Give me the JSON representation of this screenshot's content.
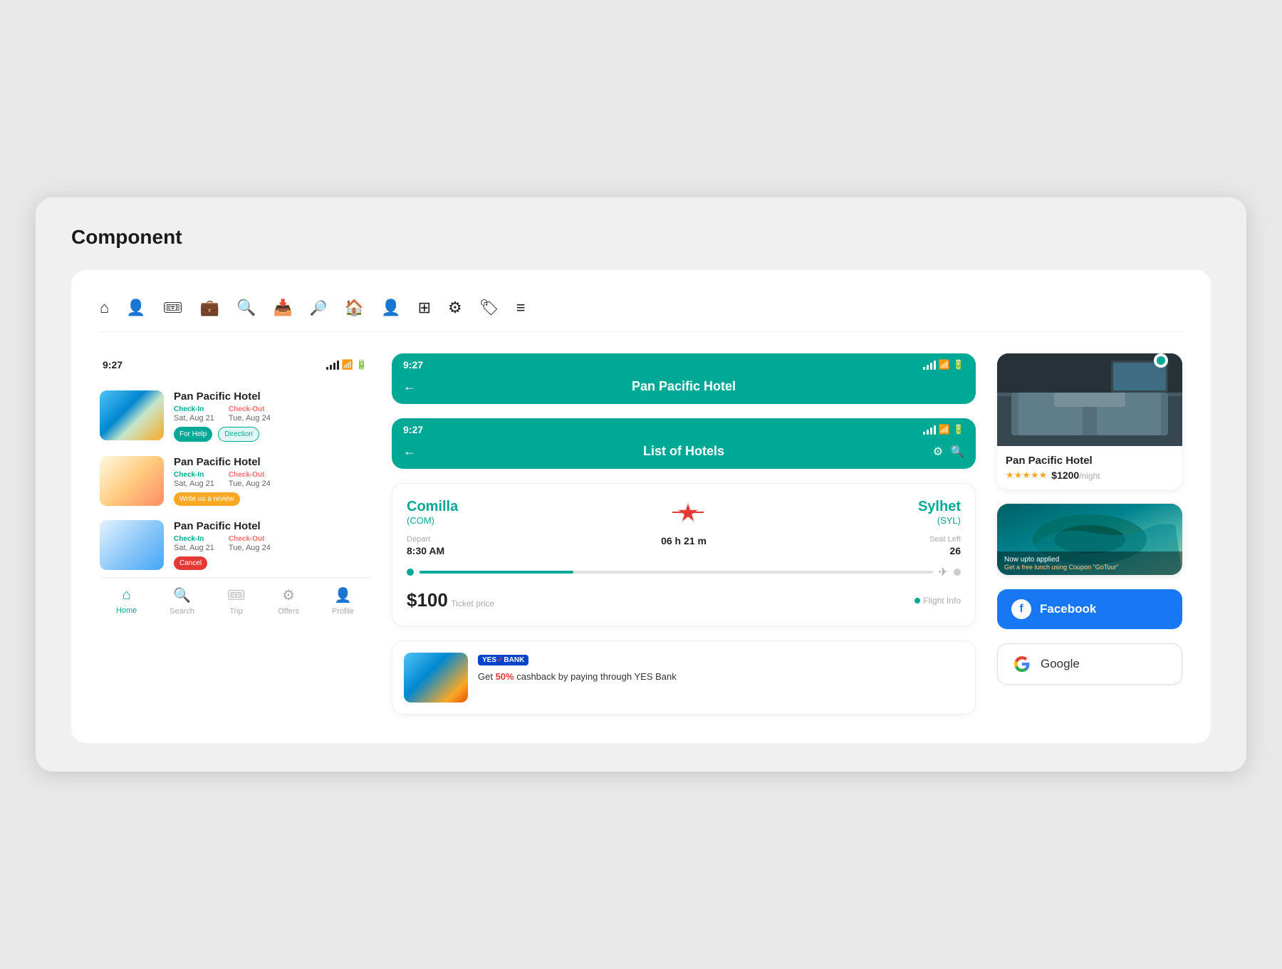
{
  "page": {
    "title": "Component",
    "background_color": "#e8e8e8"
  },
  "toolbar": {
    "icons": [
      {
        "name": "home-icon",
        "symbol": "⌂"
      },
      {
        "name": "user-icon",
        "symbol": "👤"
      },
      {
        "name": "ticket-icon",
        "symbol": "🎟"
      },
      {
        "name": "briefcase-icon",
        "symbol": "💼"
      },
      {
        "name": "search-icon",
        "symbol": "🔍"
      },
      {
        "name": "inbox-icon",
        "symbol": "📥"
      },
      {
        "name": "location-search-icon",
        "symbol": "🔎"
      },
      {
        "name": "house-filled-icon",
        "symbol": "🏠"
      },
      {
        "name": "person-filled-icon",
        "symbol": "👤"
      },
      {
        "name": "grid-icon",
        "symbol": "⊞"
      },
      {
        "name": "settings-icon",
        "symbol": "⚙"
      },
      {
        "name": "discount-icon",
        "symbol": "🏷"
      },
      {
        "name": "menu-icon",
        "symbol": "≡"
      }
    ]
  },
  "left_panel": {
    "status_time": "9:27",
    "bottom_nav": {
      "items": [
        {
          "id": "home",
          "label": "Home",
          "icon": "⌂",
          "active": true
        },
        {
          "id": "search",
          "label": "Search",
          "icon": "🔍",
          "active": false
        },
        {
          "id": "trip",
          "label": "Trip",
          "icon": "🎟",
          "active": false
        },
        {
          "id": "offers",
          "label": "Offers",
          "icon": "⚙",
          "active": false
        },
        {
          "id": "profile",
          "label": "Profile",
          "icon": "👤",
          "active": false
        }
      ]
    },
    "hotels": [
      {
        "name": "Pan Pacific Hotel",
        "image_type": "beach",
        "checkin_label": "Check-In",
        "checkout_label": "Check-Out",
        "checkin_date": "Sat, Aug 21",
        "checkout_date": "Tue, Aug 24",
        "btn1_label": "For Help",
        "btn1_type": "green",
        "btn2_label": "Direction",
        "btn2_type": "teal-outline"
      },
      {
        "name": "Pan Pacific Hotel",
        "image_type": "dining",
        "checkin_label": "Check-In",
        "checkout_label": "Check-Out",
        "checkin_date": "Sat, Aug 21",
        "checkout_date": "Tue, Aug 24",
        "btn1_label": "Write us a review",
        "btn1_type": "yellow"
      },
      {
        "name": "Pan Pacific Hotel",
        "image_type": "room",
        "checkin_label": "Check-In",
        "checkout_label": "Check-Out",
        "checkin_date": "Sat, Aug 21",
        "checkout_date": "Tue, Aug 24",
        "btn1_label": "Cancel",
        "btn1_type": "red"
      }
    ]
  },
  "middle_panel": {
    "header1": {
      "time": "9:27",
      "title": "Pan Pacific Hotel",
      "back_label": "←"
    },
    "header2": {
      "time": "9:27",
      "title": "List of Hotels",
      "back_label": "←"
    },
    "flight_card": {
      "from_city": "Comilla",
      "from_code": "(COM)",
      "to_city": "Sylhet",
      "to_code": "(SYL)",
      "depart_label": "Depart",
      "depart_time": "8:30 AM",
      "duration_label": "06 h 21 m",
      "seats_label": "Seat Left",
      "seats_count": "26",
      "price": "$100",
      "ticket_price_label": "Ticket price",
      "flight_info_label": "Flight Info"
    },
    "promo_card": {
      "bank_name": "YES BANK",
      "text": "Get ",
      "highlight": "50%",
      "text2": " cashback by paying through YES Bank"
    }
  },
  "right_panel": {
    "hotel_preview": {
      "name": "Pan Pacific Hotel",
      "stars": "★★★★★",
      "price": "$1200",
      "per_night": "/night"
    },
    "aerial_card": {
      "overlay_text": "Now upto applied",
      "coupon_text": "Get a free lunch using Coupon \"GoTour\""
    },
    "facebook_btn": {
      "label": "Facebook",
      "icon": "f"
    },
    "google_btn": {
      "label": "Google",
      "icon": "G"
    }
  }
}
